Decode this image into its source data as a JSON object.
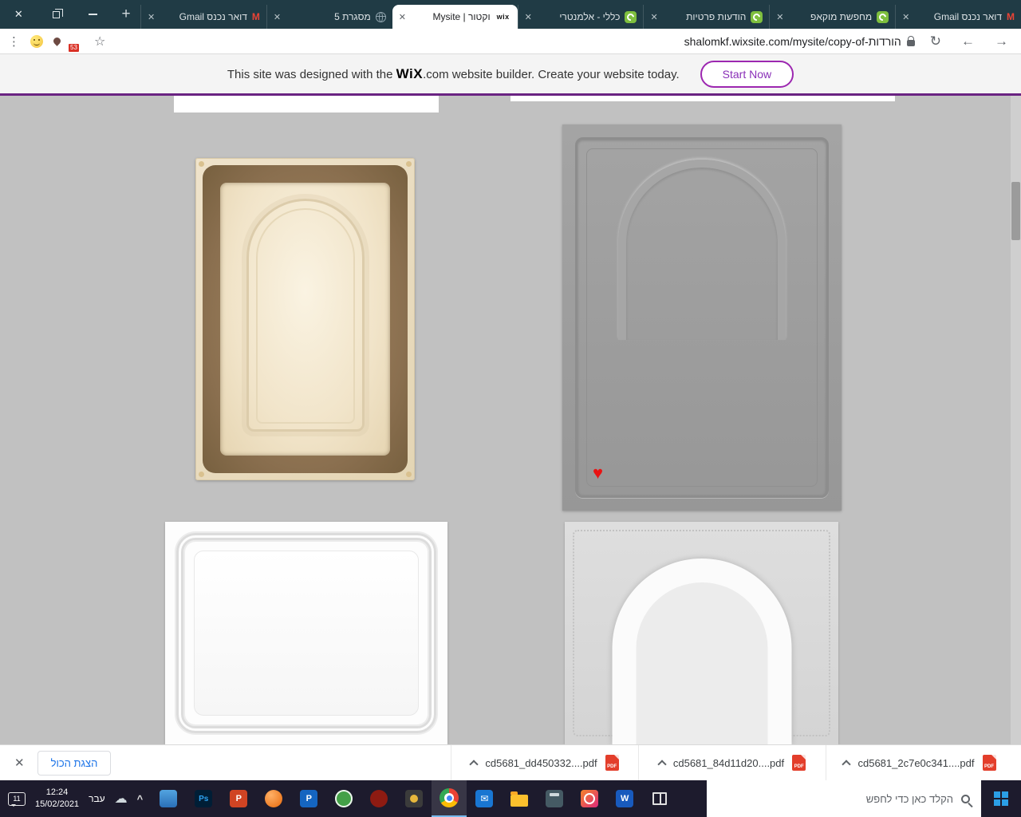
{
  "titlebar": {
    "new_tab_button": "+",
    "tabs": [
      {
        "label": "דואר נכנס Gmail",
        "favicon": "gmail"
      },
      {
        "label": "מסגרת 5",
        "favicon": "globe"
      },
      {
        "label": "Mysite | וקטור",
        "favicon": "wix",
        "active": true
      },
      {
        "label": "כללי - אלמנטרי",
        "favicon": "forum"
      },
      {
        "label": "הודעות פרטיות",
        "favicon": "forum"
      },
      {
        "label": "מחפשת מוקאפ",
        "favicon": "forum"
      },
      {
        "label": "דואר נכנס Gmail",
        "favicon": "gmail"
      }
    ]
  },
  "toolbar": {
    "url": "shalomkf.wixsite.com/mysite/copy-of-הורדות",
    "extension_badge_count": "53"
  },
  "banner": {
    "message_prefix": "This site was designed with the ",
    "brand": "WiX",
    "message_suffix": ".com website builder. Create your website today.",
    "start_button": "Start Now"
  },
  "downloads_bar": {
    "show_all_button": "הצגת הכול",
    "pdf_label": "PDF",
    "items": [
      {
        "filename": "cd5681_dd450332....pdf"
      },
      {
        "filename": "cd5681_84d11d20....pdf"
      },
      {
        "filename": "cd5681_2c7e0c341....pdf"
      }
    ]
  },
  "taskbar": {
    "notification_count": "11",
    "clock": {
      "time": "12:24",
      "date": "15/02/2021"
    },
    "language_indicator": "עבר",
    "search_placeholder": "הקלד כאן כדי לחפש",
    "apps": [
      "file-explorer",
      "photoshop",
      "powerpoint",
      "orange-app",
      "publisher",
      "green-app",
      "red-app",
      "gold-app",
      "chrome",
      "mail",
      "folder",
      "calculator",
      "camera-app",
      "word",
      "task-view"
    ]
  },
  "icons": {
    "close": "✕",
    "menu": "⋮",
    "star": "☆",
    "reload": "↻",
    "back": "←",
    "forward": "→",
    "gmail_m": "M",
    "wix": "wix",
    "cloud": "☁",
    "caret": "^",
    "heart": "♥",
    "envelope": "✉",
    "ps": "Ps",
    "p": "P",
    "w": "W"
  }
}
